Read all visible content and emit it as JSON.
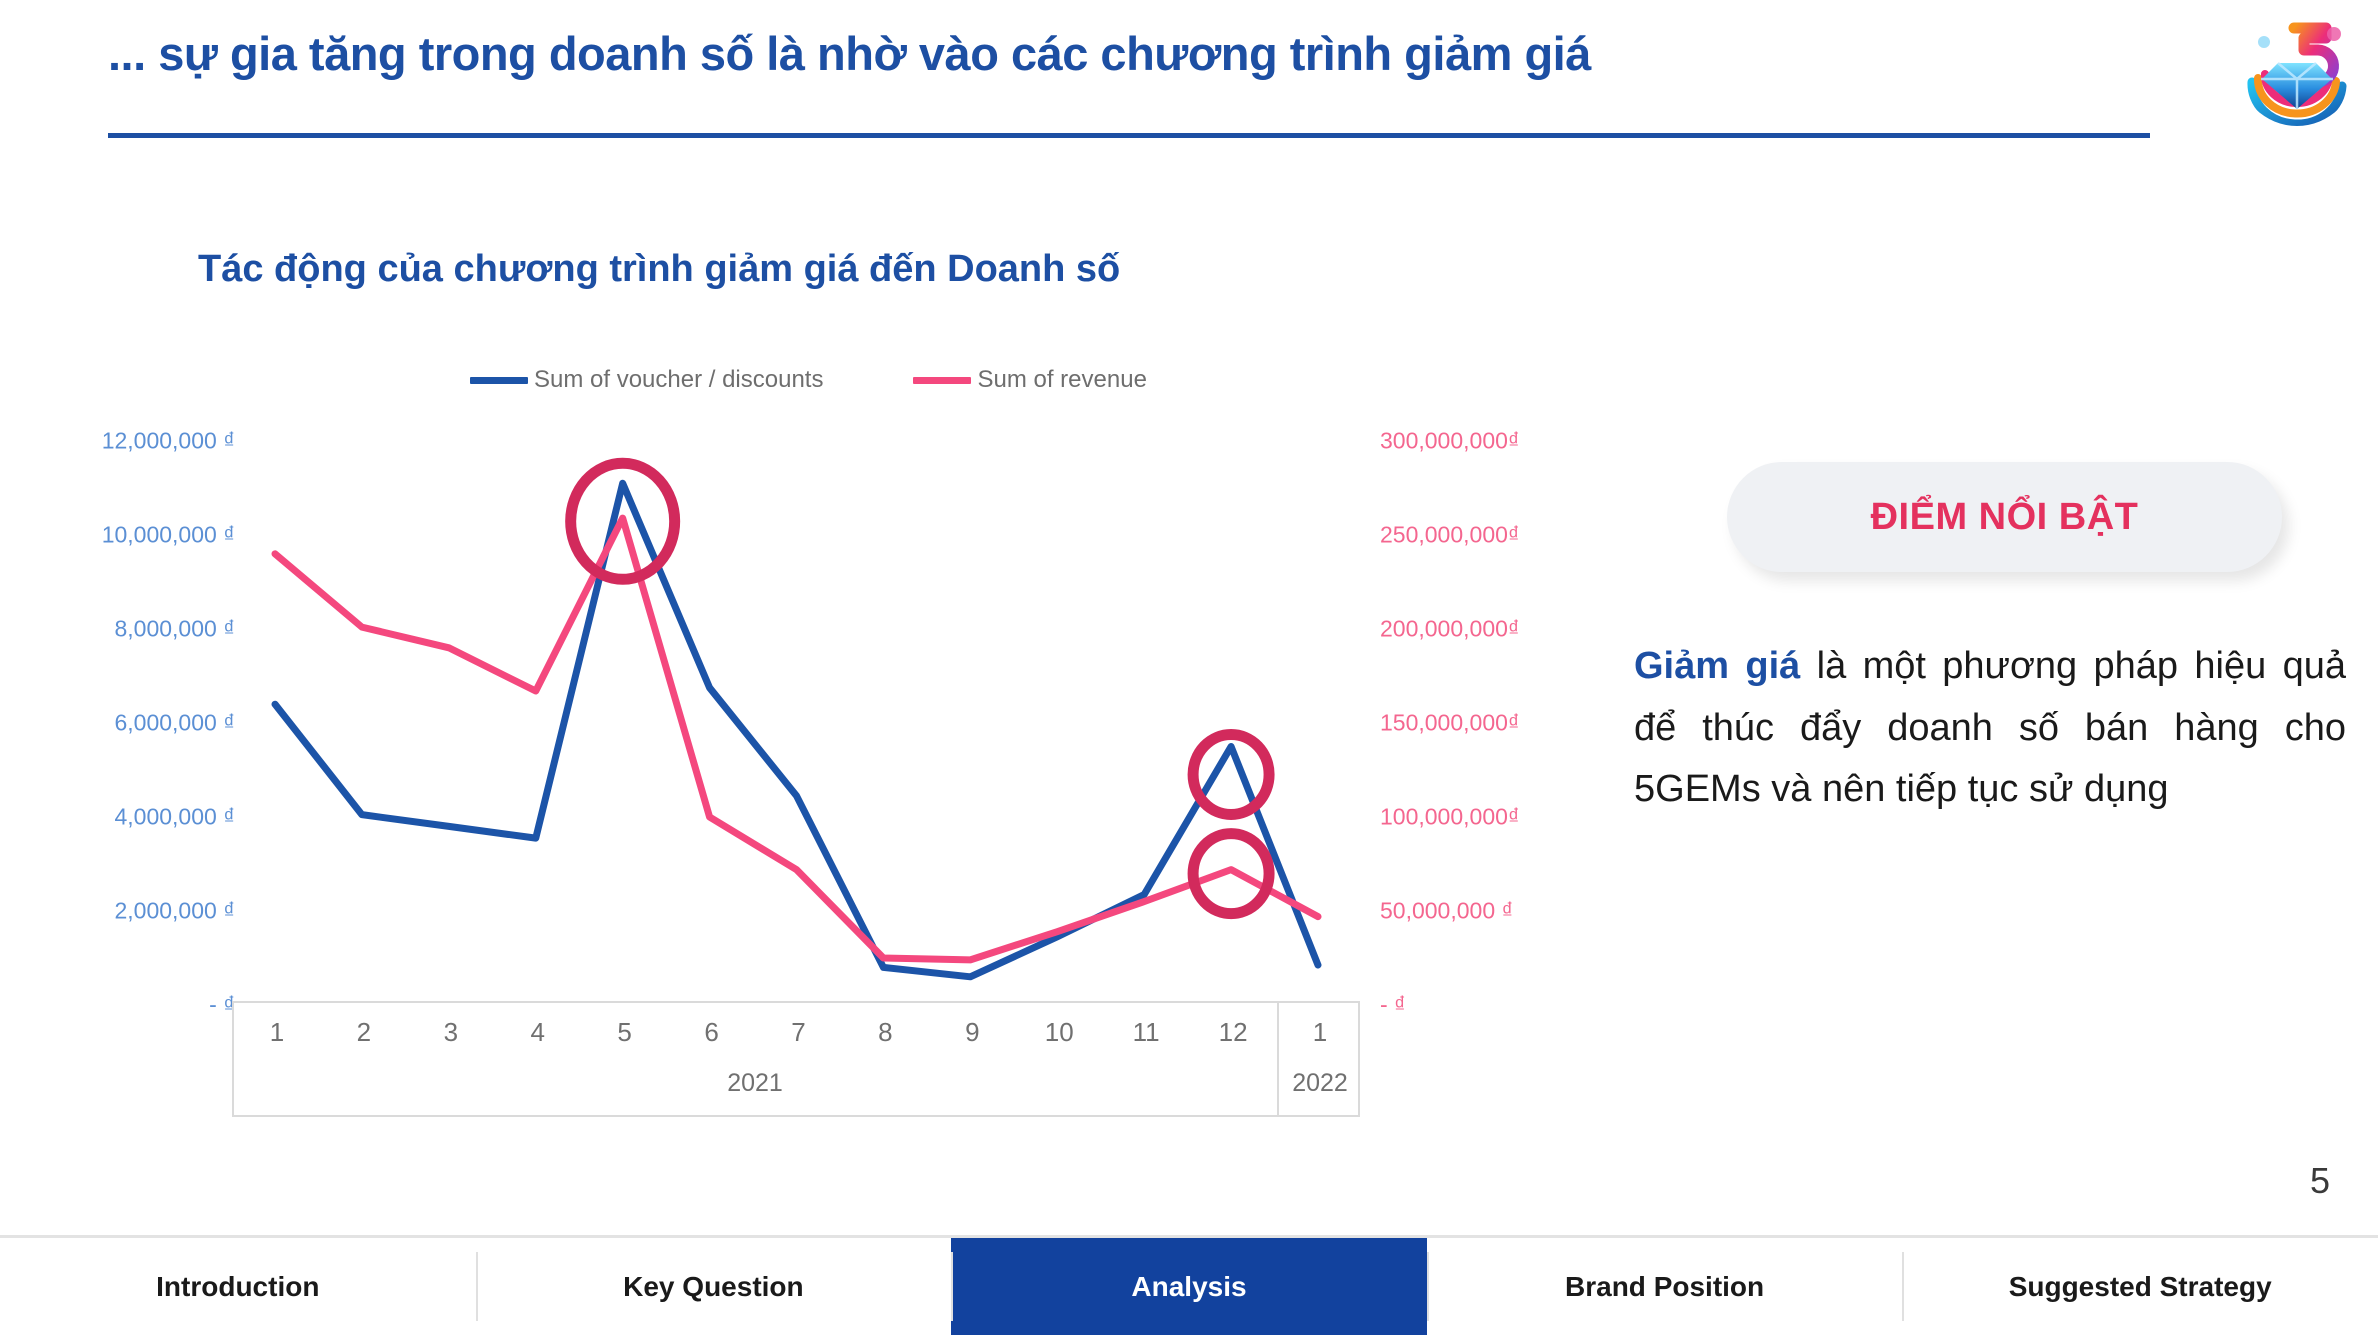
{
  "header": {
    "title": "... sự gia tăng trong doanh số là nhờ vào các chương trình giảm giá",
    "logo_name": "5gems-logo",
    "accent_color": "#1d4fa3"
  },
  "chart": {
    "title": "Tác động của chương trình giảm giá đến Doanh số",
    "legend": [
      {
        "label": "Sum of voucher / discounts",
        "color": "#1c54a8"
      },
      {
        "label": "Sum of revenue",
        "color": "#f4487e"
      }
    ],
    "y_axis_left": [
      "12,000,000 ₫",
      "10,000,000 ₫",
      "8,000,000 ₫",
      "6,000,000 ₫",
      "4,000,000 ₫",
      "2,000,000 ₫",
      "-   ₫"
    ],
    "y_axis_right": [
      "300,000,000₫",
      "250,000,000₫",
      "200,000,000₫",
      "150,000,000₫",
      "100,000,000₫",
      "50,000,000 ₫",
      "-   ₫"
    ],
    "x_months": [
      "1",
      "2",
      "3",
      "4",
      "5",
      "6",
      "7",
      "8",
      "9",
      "10",
      "11",
      "12",
      "1"
    ],
    "x_years": [
      {
        "label": "2021",
        "span_start": 0,
        "span_end": 11
      },
      {
        "label": "2022",
        "span_start": 12,
        "span_end": 12
      }
    ],
    "highlight_color": "#d22a5c"
  },
  "chart_data": {
    "type": "line",
    "title": "Tác động của chương trình giảm giá đến Doanh số",
    "xlabel": "",
    "ylabel": "",
    "grid": false,
    "legend_position": "top",
    "categories": [
      "2021-1",
      "2021-2",
      "2021-3",
      "2021-4",
      "2021-5",
      "2021-6",
      "2021-7",
      "2021-8",
      "2021-9",
      "2021-10",
      "2021-11",
      "2021-12",
      "2022-1"
    ],
    "tick_labels_x": [
      "1",
      "2",
      "3",
      "4",
      "5",
      "6",
      "7",
      "8",
      "9",
      "10",
      "11",
      "12",
      "1"
    ],
    "series": [
      {
        "name": "Sum of voucher / discounts",
        "color": "#1c54a8",
        "axis": "left",
        "ylim": [
          0,
          12000000
        ],
        "yticks": [
          0,
          2000000,
          4000000,
          6000000,
          8000000,
          10000000,
          12000000
        ],
        "ytick_labels": [
          "-   ₫",
          "2,000,000 ₫",
          "4,000,000 ₫",
          "6,000,000 ₫",
          "8,000,000 ₫",
          "10,000,000 ₫",
          "12,000,000 ₫"
        ],
        "values": [
          6400000,
          4050000,
          3800000,
          3550000,
          11100000,
          6750000,
          4450000,
          800000,
          600000,
          1450000,
          2350000,
          5500000,
          850000
        ]
      },
      {
        "name": "Sum of revenue",
        "color": "#f4487e",
        "axis": "right",
        "ylim": [
          0,
          300000000
        ],
        "yticks": [
          0,
          50000000,
          100000000,
          150000000,
          200000000,
          250000000,
          300000000
        ],
        "ytick_labels": [
          "-   ₫",
          "50,000,000 ₫",
          "100,000,000₫",
          "150,000,000₫",
          "200,000,000₫",
          "250,000,000₫",
          "300,000,000₫"
        ],
        "values": [
          240000000,
          201000000,
          190000000,
          167000000,
          259000000,
          100000000,
          72000000,
          25000000,
          24000000,
          39000000,
          55000000,
          72000000,
          47000000
        ]
      }
    ],
    "annotations": [
      {
        "type": "circle",
        "label": "peak-may-2021",
        "series": "both",
        "x": "2021-5"
      },
      {
        "type": "circle",
        "label": "peak-dec-2021-voucher",
        "series": "Sum of voucher / discounts",
        "x": "2021-12"
      },
      {
        "type": "circle",
        "label": "peak-dec-2021-revenue",
        "series": "Sum of revenue",
        "x": "2021-12"
      }
    ]
  },
  "insight": {
    "badge": "ĐIỂM NỔI BẬT",
    "highlight": "Giảm giá",
    "body": " là một phương pháp hiệu quả để thúc đẩy doanh số bán hàng cho 5GEMs và nên tiếp tục sử dụng"
  },
  "page_number": "5",
  "footer": {
    "items": [
      {
        "label": "Introduction",
        "active": false
      },
      {
        "label": "Key Question",
        "active": false
      },
      {
        "label": "Analysis",
        "active": true
      },
      {
        "label": "Brand Position",
        "active": false
      },
      {
        "label": "Suggested Strategy",
        "active": false
      }
    ],
    "active_color": "#12429e"
  }
}
